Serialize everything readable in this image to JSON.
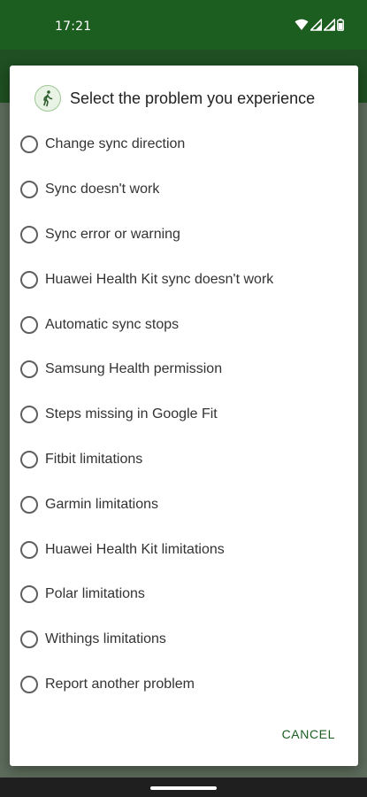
{
  "status_bar": {
    "time": "17:21",
    "icons": [
      "wifi-icon",
      "signal-icon",
      "signal-icon",
      "battery-icon"
    ]
  },
  "colors": {
    "accent": "#1b5e20",
    "status_bar": "#1b5e20",
    "dialog_bg": "#ffffff",
    "scrim": "#5c6b5b"
  },
  "dialog": {
    "icon": "walking-person-icon",
    "title": "Select the problem you experience",
    "options": [
      "Change sync direction",
      "Sync doesn't work",
      "Sync error or warning",
      "Huawei Health Kit sync doesn't work",
      "Automatic sync stops",
      "Samsung Health permission",
      "Steps missing in Google Fit",
      "Fitbit limitations",
      "Garmin limitations",
      "Huawei Health Kit limitations",
      "Polar limitations",
      "Withings limitations",
      "Report another problem"
    ],
    "cancel_label": "CANCEL"
  }
}
